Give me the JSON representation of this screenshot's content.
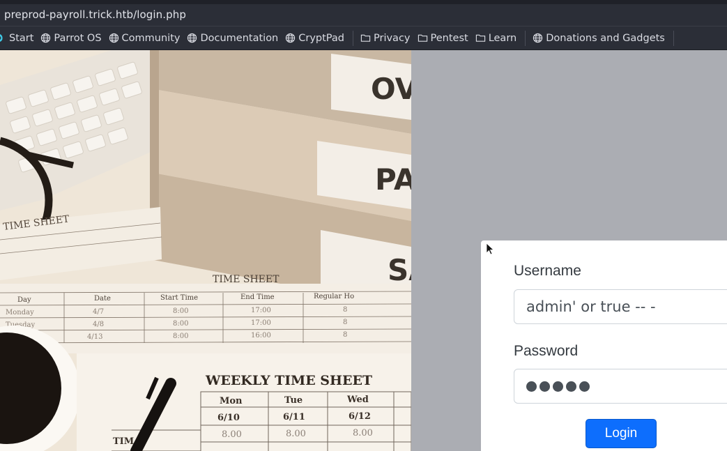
{
  "browser": {
    "url": "preprod-payroll.trick.htb/login.php"
  },
  "bookmarks": [
    {
      "label": "Start",
      "icon": "parrot-icon"
    },
    {
      "label": "Parrot OS",
      "icon": "globe-icon"
    },
    {
      "label": "Community",
      "icon": "globe-icon"
    },
    {
      "label": "Documentation",
      "icon": "globe-icon"
    },
    {
      "label": "CryptPad",
      "icon": "globe-icon"
    },
    {
      "label": "Privacy",
      "icon": "folder-icon"
    },
    {
      "label": "Pentest",
      "icon": "folder-icon"
    },
    {
      "label": "Learn",
      "icon": "folder-icon"
    },
    {
      "label": "Donations and Gadgets",
      "icon": "globe-icon"
    }
  ],
  "photo": {
    "binder_labels": [
      "OV",
      "PA",
      "SA"
    ],
    "sheet_titles": [
      "TIME SHEET",
      "TIME SHEET",
      "WEEKLY TIME SHEET"
    ],
    "table_headers": [
      "Day",
      "Date",
      "Start Time",
      "End Time",
      "Regular Ho"
    ],
    "table_rows": [
      [
        "Monday",
        "4/7",
        "8:00",
        "17:00",
        "8"
      ],
      [
        "Tuesday",
        "4/8",
        "8:00",
        "17:00",
        "8"
      ],
      [
        "",
        "4/13",
        "8:00",
        "16:00",
        "8"
      ]
    ],
    "weekly_days": [
      "Mon",
      "Tue",
      "Wed"
    ],
    "weekly_dates": [
      "6/10",
      "6/11",
      "6/12"
    ],
    "weekly_hours": [
      "8.00",
      "8.00",
      "8.00"
    ],
    "weekly_row_label": "TIM"
  },
  "login": {
    "username_label": "Username",
    "username_value": "admin' or true -- -",
    "password_label": "Password",
    "password_masked_length": 5,
    "login_button": "Login"
  },
  "colors": {
    "primary_button": "#0d6efd",
    "page_background": "#abadb3",
    "browser_chrome": "#2b2e37"
  }
}
